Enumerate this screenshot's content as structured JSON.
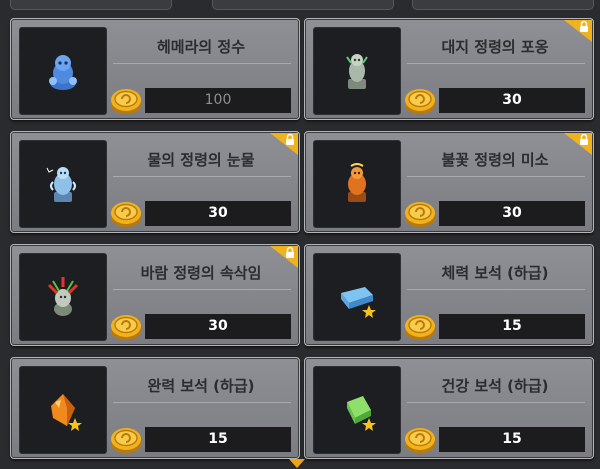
{
  "items": [
    {
      "name": "헤메라의 정수",
      "price": "100",
      "locked": false,
      "icon": "blue-hooded-figure-icon",
      "price_dim": true
    },
    {
      "name": "대지 정령의 포옹",
      "price": "30",
      "locked": true,
      "icon": "earth-spirit-statue-icon",
      "price_dim": false
    },
    {
      "name": "물의 정령의 눈물",
      "price": "30",
      "locked": true,
      "icon": "water-spirit-statue-icon",
      "price_dim": false
    },
    {
      "name": "불꽃 정령의 미소",
      "price": "30",
      "locked": true,
      "icon": "fire-spirit-statue-icon",
      "price_dim": false
    },
    {
      "name": "바람 정령의 속삭임",
      "price": "30",
      "locked": true,
      "icon": "wind-spirit-statue-icon",
      "price_dim": false
    },
    {
      "name": "체력 보석 (하급)",
      "price": "15",
      "locked": false,
      "icon": "blue-gem-icon",
      "price_dim": false
    },
    {
      "name": "완력 보석 (하급)",
      "price": "15",
      "locked": false,
      "icon": "orange-gem-icon",
      "price_dim": false
    },
    {
      "name": "건강 보석 (하급)",
      "price": "15",
      "locked": false,
      "icon": "green-gem-icon",
      "price_dim": false
    }
  ],
  "colors": {
    "card": "#87888d",
    "price_box": "#1c1c1e",
    "lock_badge": "#f0b31d",
    "coin": "#f2b21c"
  }
}
